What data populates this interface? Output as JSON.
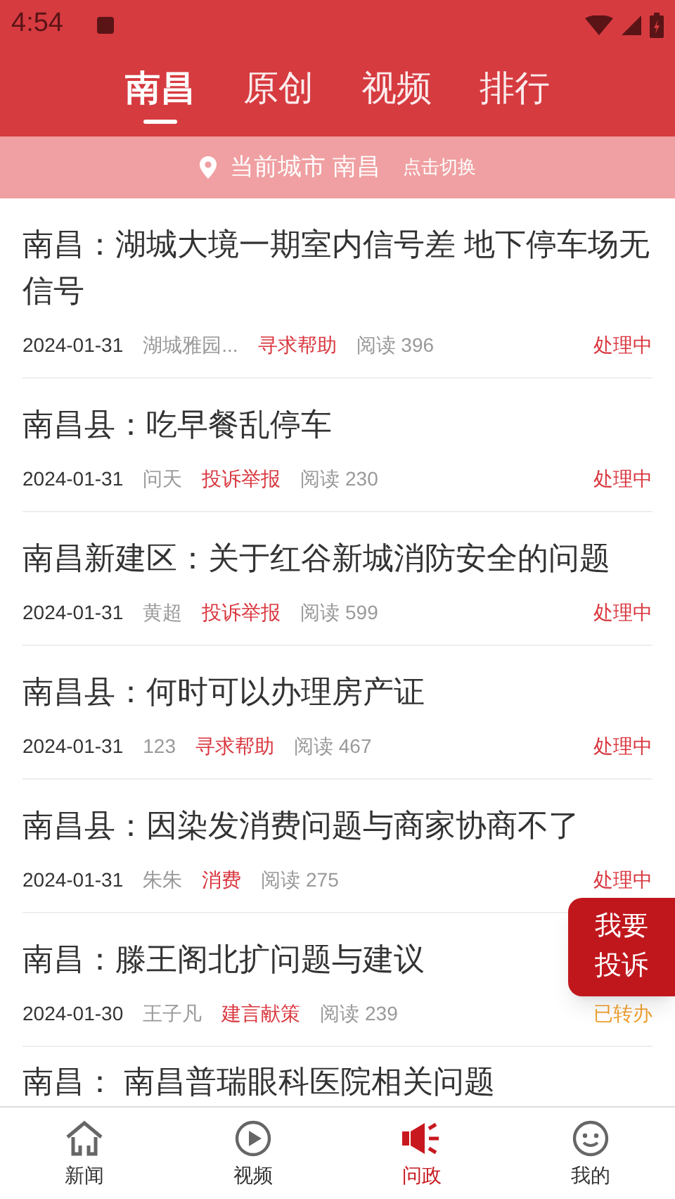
{
  "status_bar": {
    "time": "4:54"
  },
  "tabs": [
    {
      "label": "南昌",
      "selected": true
    },
    {
      "label": "原创",
      "selected": false
    },
    {
      "label": "视频",
      "selected": false
    },
    {
      "label": "排行",
      "selected": false
    }
  ],
  "city_bar": {
    "label": "当前城市 南昌",
    "action": "点击切换"
  },
  "posts": [
    {
      "title": "南昌：湖城大境一期室内信号差 地下停车场无信号",
      "date": "2024-01-31",
      "author": "湖城雅园...",
      "tag": "寻求帮助",
      "reads": "阅读 396",
      "status": "处理中",
      "color": "#d9363e"
    },
    {
      "title": "南昌县：吃早餐乱停车",
      "date": "2024-01-31",
      "author": "问天",
      "tag": "投诉举报",
      "reads": "阅读 230",
      "status": "处理中",
      "color": "#d9363e"
    },
    {
      "title": "南昌新建区：关于红谷新城消防安全的问题",
      "date": "2024-01-31",
      "author": "黄超",
      "tag": "投诉举报",
      "reads": "阅读 599",
      "status": "处理中",
      "color": "#d9363e"
    },
    {
      "title": "南昌县：何时可以办理房产证",
      "date": "2024-01-31",
      "author": "123",
      "tag": "寻求帮助",
      "reads": "阅读 467",
      "status": "处理中",
      "color": "#d9363e"
    },
    {
      "title": "南昌县：因染发消费问题与商家协商不了",
      "date": "2024-01-31",
      "author": "朱朱",
      "tag": "消费",
      "reads": "阅读 275",
      "status": "处理中",
      "color": "#d9363e"
    },
    {
      "title": "南昌：滕王阁北扩问题与建议",
      "date": "2024-01-30",
      "author": "王子凡",
      "tag": "建言献策",
      "reads": "阅读 239",
      "status": "已转办",
      "color": "#f0a030"
    },
    {
      "title": "南昌：  南昌普瑞眼科医院相关问题"
    }
  ],
  "fab": {
    "label": "我要投诉"
  },
  "bottom_nav": [
    {
      "label": "新闻",
      "selected": false
    },
    {
      "label": "视频",
      "selected": false
    },
    {
      "label": "问政",
      "selected": true
    },
    {
      "label": "我的",
      "selected": false
    }
  ]
}
